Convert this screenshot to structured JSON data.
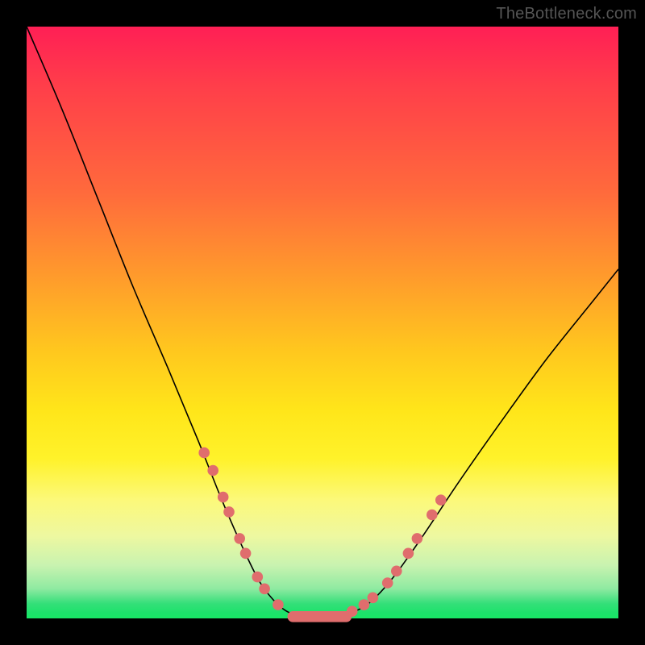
{
  "attribution": "TheBottleneck.com",
  "colors": {
    "frame": "#000000",
    "top": "#ff1f55",
    "bottom": "#18e765",
    "curve": "#000000",
    "marker": "#e06d6d"
  },
  "chart_data": {
    "type": "line",
    "title": "",
    "xlabel": "",
    "ylabel": "",
    "xlim": [
      0,
      100
    ],
    "ylim": [
      0,
      100
    ],
    "series": [
      {
        "name": "curve",
        "x": [
          0,
          6,
          12,
          18,
          24,
          29,
          33,
          36.5,
          39.5,
          42.5,
          45,
          48,
          51,
          54.5,
          58,
          62,
          67,
          73,
          80,
          88,
          96,
          100
        ],
        "values": [
          100,
          86,
          71,
          56,
          42,
          30,
          20,
          12,
          6,
          2.3,
          0.7,
          0,
          0,
          0.8,
          2.7,
          7,
          14,
          23,
          33,
          44,
          54,
          59
        ]
      }
    ],
    "markers": {
      "left_descent": [
        {
          "x": 30,
          "y": 28
        },
        {
          "x": 31.5,
          "y": 25
        },
        {
          "x": 33.2,
          "y": 20.5
        },
        {
          "x": 34.2,
          "y": 18
        },
        {
          "x": 36,
          "y": 13.5
        },
        {
          "x": 37,
          "y": 11
        },
        {
          "x": 39,
          "y": 7
        },
        {
          "x": 40.2,
          "y": 5
        },
        {
          "x": 42.5,
          "y": 2.3
        }
      ],
      "right_ascent": [
        {
          "x": 55,
          "y": 1.2
        },
        {
          "x": 57,
          "y": 2.3
        },
        {
          "x": 58.5,
          "y": 3.5
        },
        {
          "x": 61,
          "y": 6
        },
        {
          "x": 62.5,
          "y": 8
        },
        {
          "x": 64.5,
          "y": 11
        },
        {
          "x": 66,
          "y": 13.5
        },
        {
          "x": 68.5,
          "y": 17.5
        },
        {
          "x": 70,
          "y": 20
        }
      ],
      "valley_pill": {
        "x_start": 45,
        "x_end": 54,
        "y": 0.3
      }
    }
  }
}
